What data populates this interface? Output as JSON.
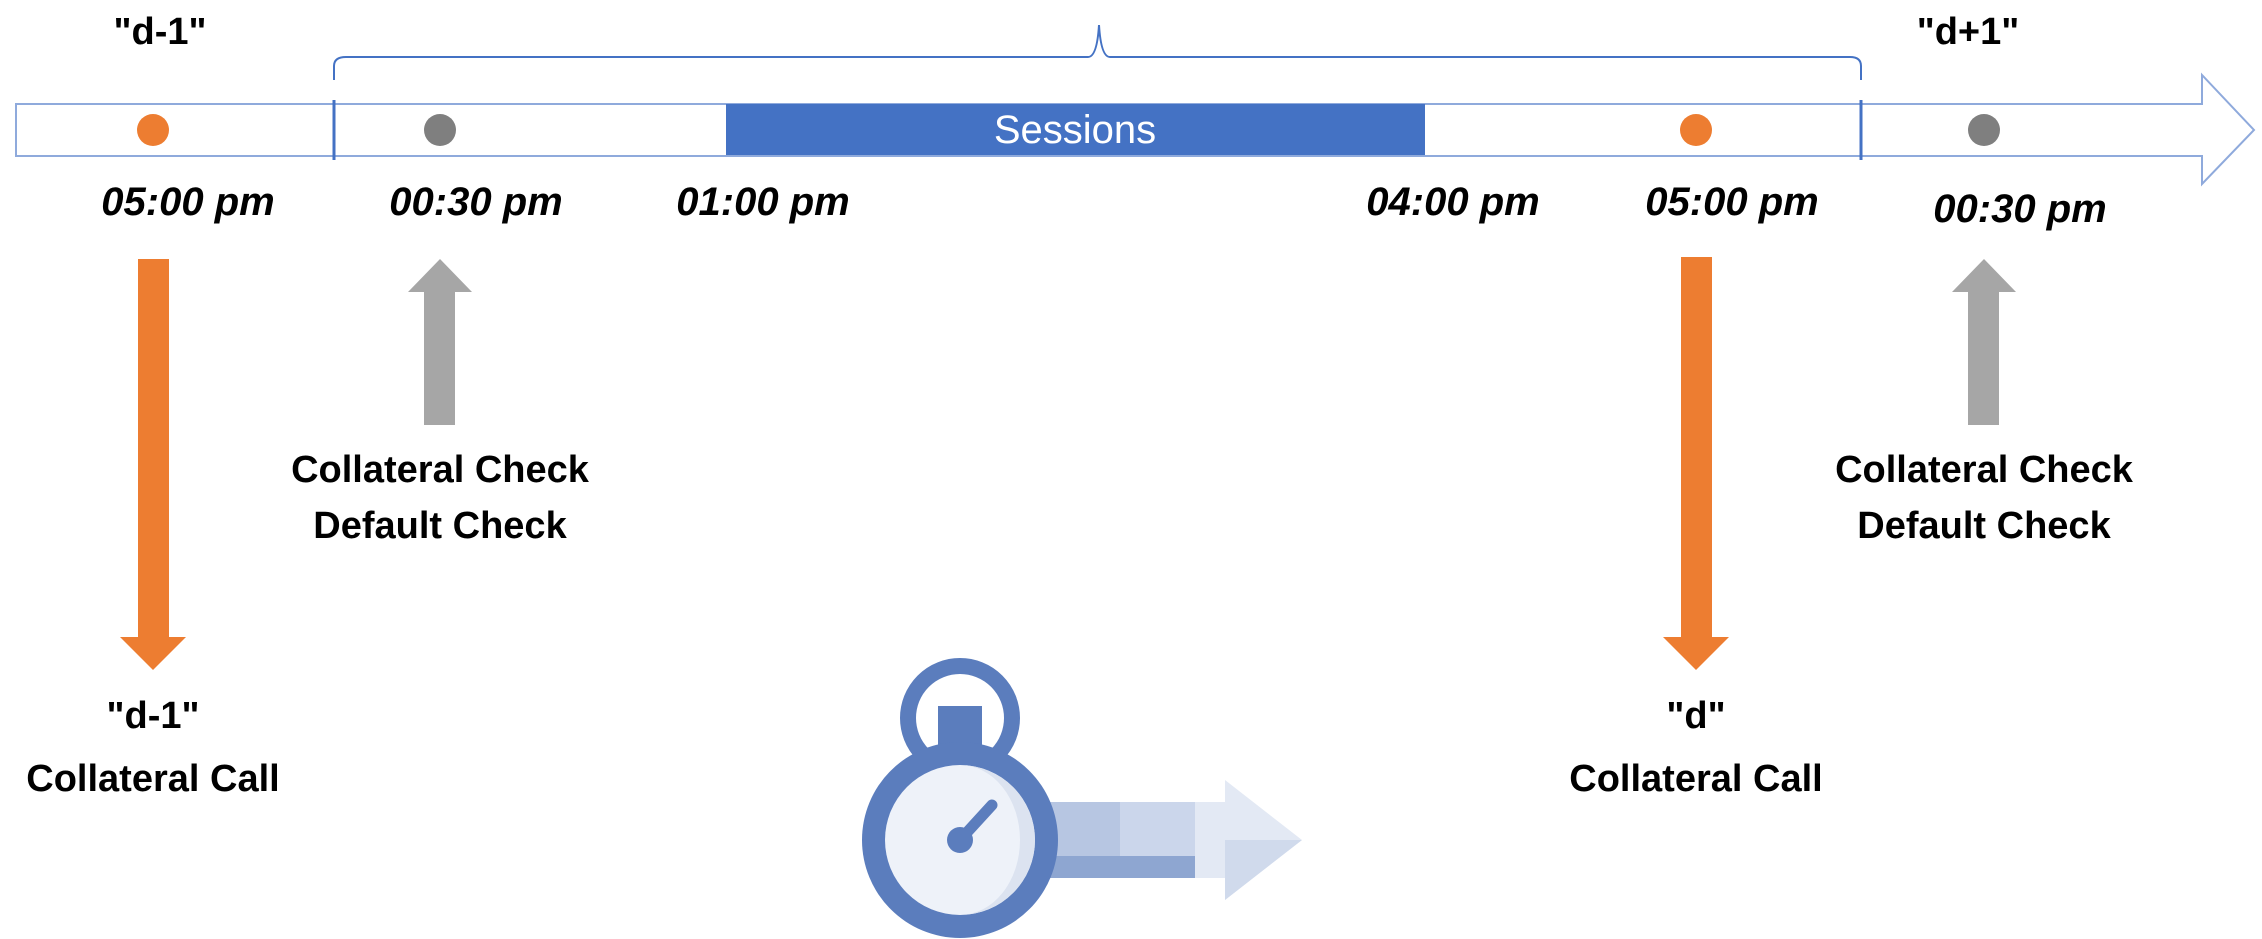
{
  "days": {
    "prev": "\"d-1\"",
    "next": "\"d+1\""
  },
  "sessions_label": "Sessions",
  "times": {
    "t1": "05:00 pm",
    "t2": "00:30 pm",
    "t3": "01:00 pm",
    "t4": "04:00 pm",
    "t5": "05:00 pm",
    "t6": "00:30 pm"
  },
  "events": {
    "call_prev": {
      "line1": "\"d-1\"",
      "line2": "Collateral Call"
    },
    "check_1": {
      "line1": "Collateral Check",
      "line2": "Default Check"
    },
    "call_d": {
      "line1": "\"d\"",
      "line2": "Collateral Call"
    },
    "check_2": {
      "line1": "Collateral Check",
      "line2": "Default Check"
    }
  },
  "colors": {
    "orange": "#ED7D31",
    "gray_dot": "#7F7F7F",
    "gray_arrow": "#A6A6A6",
    "blue": "#4472C4",
    "timeline_border": "#8FAADC",
    "stopwatch": "#5B7DBD"
  },
  "icons": {
    "stopwatch": "stopwatch-icon"
  }
}
